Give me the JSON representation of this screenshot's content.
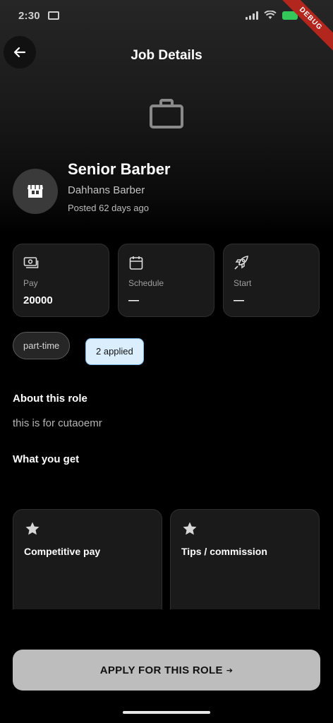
{
  "status_bar": {
    "time": "2:30",
    "debug_label": "DEBUG",
    "battery_color": "#34c759"
  },
  "top_bar": {
    "back_icon": "arrow-left-icon",
    "title": "Job Details"
  },
  "hero_icon": "briefcase-icon",
  "job": {
    "title": "Senior Barber",
    "company": "Dahhans Barber",
    "posted": "Posted 62 days ago",
    "avatar_icon": "store-icon"
  },
  "info_cards": [
    {
      "icon": "cash-icon",
      "label": "Pay",
      "value": "20000"
    },
    {
      "icon": "calendar-icon",
      "label": "Schedule",
      "value": "—"
    },
    {
      "icon": "rocket-icon",
      "label": "Start",
      "value": "—"
    }
  ],
  "chips": {
    "type": "part-time",
    "applied": "2 applied"
  },
  "about": {
    "heading": "About this role",
    "text": "this is for cutaoemr"
  },
  "benefits": {
    "heading": "What you get",
    "items": [
      {
        "icon": "star-icon",
        "label": "Competitive pay"
      },
      {
        "icon": "star-icon",
        "label": "Tips / commission"
      }
    ]
  },
  "apply": {
    "label": "APPLY FOR THIS ROLE",
    "arrow": "➔"
  },
  "colors": {
    "background": "#000000",
    "card": "#1a1a1a",
    "applied_chip": "#dbeefe",
    "apply_button": "#bdbdbd"
  }
}
